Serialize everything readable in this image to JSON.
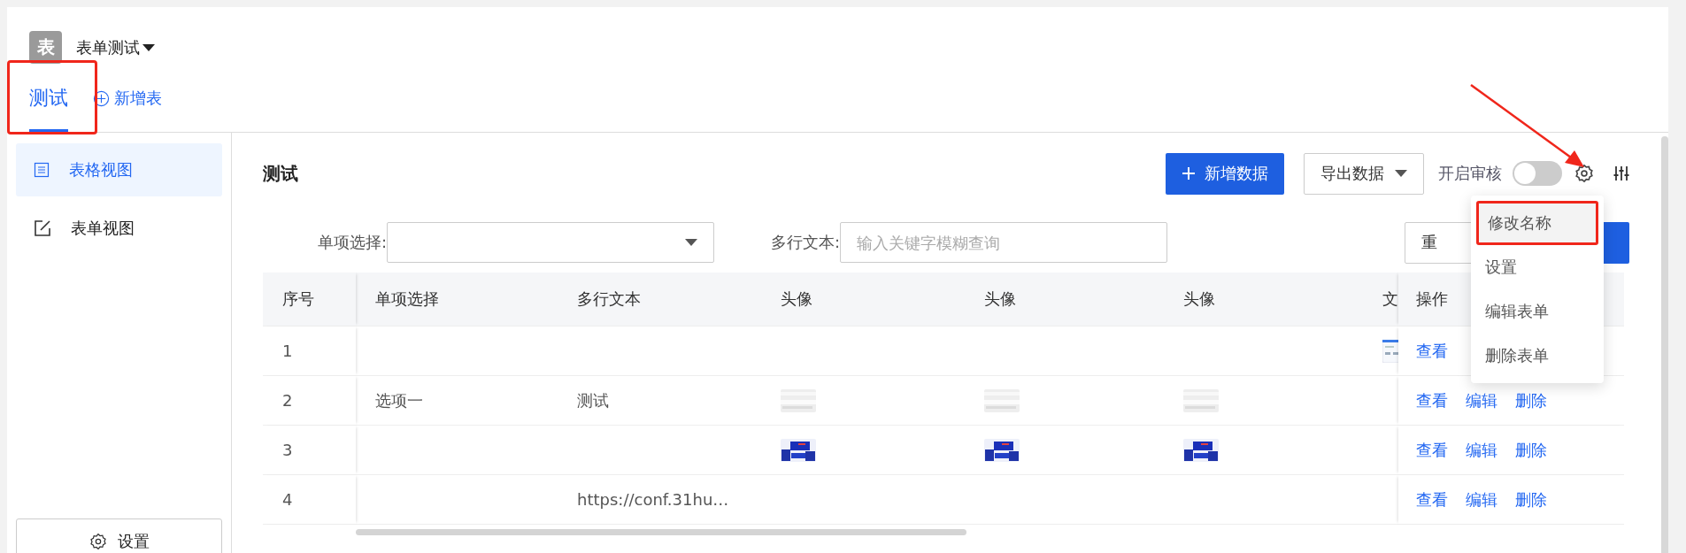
{
  "app": {
    "logo": "表",
    "title": "表单测试"
  },
  "tabs": [
    {
      "label": "测试",
      "selected": true,
      "highlighted": true
    }
  ],
  "add_table": "新增表",
  "sidebar": {
    "items": [
      {
        "label": "表格视图",
        "kind": "list",
        "selected": true
      },
      {
        "label": "表单视图",
        "kind": "edit",
        "selected": false
      }
    ],
    "settings": "设置"
  },
  "page_title": "测试",
  "toolbar": {
    "add": "新增数据",
    "export": "导出数据",
    "review_label": "开启审核",
    "review_on": false,
    "settings_pointed": true
  },
  "menu": [
    {
      "label": "修改名称",
      "hovered": true,
      "highlighted": true
    },
    {
      "label": "设置",
      "hovered": false,
      "highlighted": false
    },
    {
      "label": "编辑表单",
      "hovered": false,
      "highlighted": false
    },
    {
      "label": "删除表单",
      "hovered": false,
      "highlighted": false
    }
  ],
  "filters": [
    {
      "label": "单项选择:",
      "kind": "select"
    },
    {
      "label": "多行文本:",
      "kind": "text",
      "placeholder": "输入关键字模糊查询"
    }
  ],
  "reset": "重",
  "table": {
    "columns": [
      "序号",
      "单项选择",
      "多行文本",
      "头像",
      "头像",
      "头像",
      "文",
      "操作"
    ],
    "rows": [
      {
        "cells": [
          {
            "kind": "text",
            "text": "1"
          },
          {
            "kind": "empty"
          },
          {
            "kind": "empty"
          },
          {
            "kind": "empty"
          },
          {
            "kind": "empty"
          },
          {
            "kind": "empty"
          },
          {
            "kind": "picture"
          }
        ],
        "actions": [
          "查看"
        ]
      },
      {
        "cells": [
          {
            "kind": "text",
            "text": "2"
          },
          {
            "kind": "text",
            "text": "选项一"
          },
          {
            "kind": "text",
            "text": "测试"
          },
          {
            "kind": "picture"
          },
          {
            "kind": "picture"
          },
          {
            "kind": "picture"
          },
          {
            "kind": "empty"
          }
        ],
        "actions": [
          "查看",
          "编辑",
          "删除"
        ]
      },
      {
        "cells": [
          {
            "kind": "text",
            "text": "3"
          },
          {
            "kind": "empty"
          },
          {
            "kind": "empty"
          },
          {
            "kind": "picture"
          },
          {
            "kind": "picture"
          },
          {
            "kind": "picture"
          },
          {
            "kind": "empty"
          }
        ],
        "actions": [
          "查看",
          "编辑",
          "删除"
        ]
      },
      {
        "cells": [
          {
            "kind": "text",
            "text": "4"
          },
          {
            "kind": "empty"
          },
          {
            "kind": "text",
            "text": "https://conf.31hu…"
          },
          {
            "kind": "empty"
          },
          {
            "kind": "empty"
          },
          {
            "kind": "empty"
          },
          {
            "kind": "empty"
          }
        ],
        "actions": [
          "查看",
          "编辑",
          "删除"
        ]
      }
    ]
  }
}
